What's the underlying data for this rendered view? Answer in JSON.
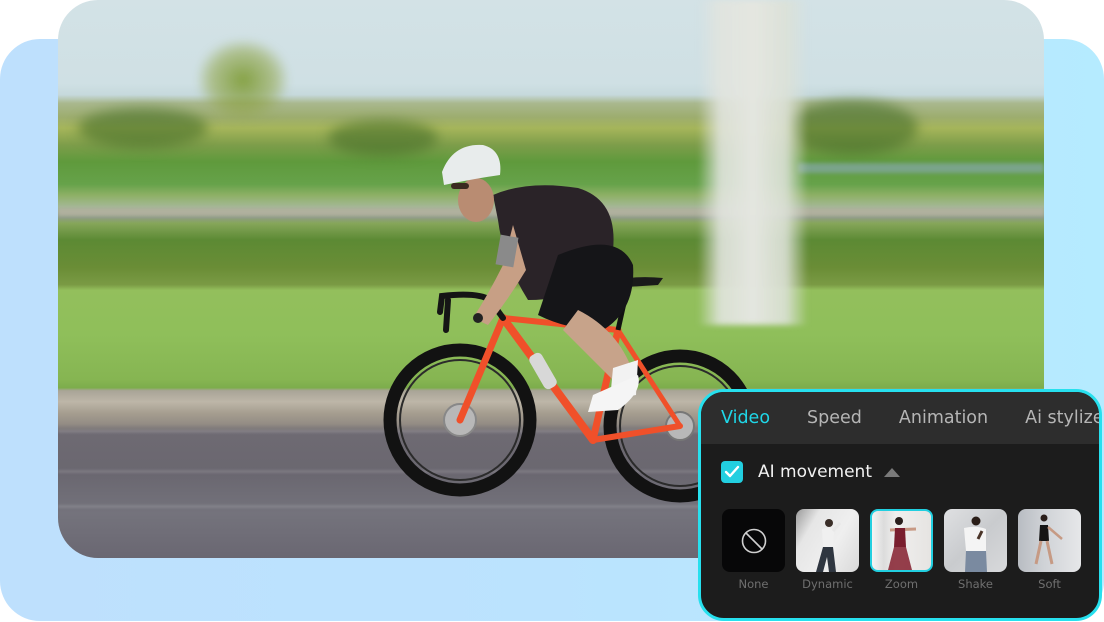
{
  "photo": {
    "subject": "cyclist riding orange road bike, motion-blurred grass and road background"
  },
  "panel": {
    "accent_color": "#22cfe0",
    "tabs": [
      {
        "label": "Video",
        "active": true
      },
      {
        "label": "Speed",
        "active": false
      },
      {
        "label": "Animation",
        "active": false
      },
      {
        "label": "Ai stylize",
        "active": false
      }
    ],
    "section": {
      "label": "AI movement",
      "checked": true,
      "expanded": true
    },
    "effects": [
      {
        "label": "None",
        "icon": "no-symbol-icon",
        "selected": false
      },
      {
        "label": "Dynamic",
        "selected": false
      },
      {
        "label": "Zoom",
        "selected": true
      },
      {
        "label": "Shake",
        "selected": false
      },
      {
        "label": "Soft",
        "selected": false
      }
    ]
  }
}
